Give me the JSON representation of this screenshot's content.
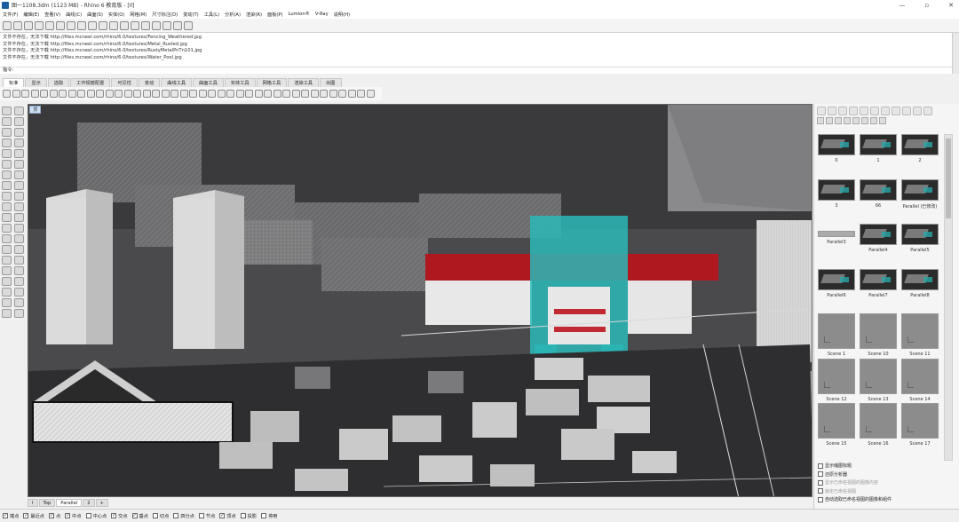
{
  "window": {
    "title": "图一1108.3dm (1123 MB) - Rhino 6 教育版 - [Il]",
    "controls": [
      "—",
      "▫",
      "✕"
    ]
  },
  "menu": [
    "文件(F)",
    "编辑(E)",
    "查看(V)",
    "曲线(C)",
    "曲面(S)",
    "实体(O)",
    "网格(M)",
    "尺寸标注(D)",
    "变动(T)",
    "工具(L)",
    "分析(A)",
    "渲染(R)",
    "面板(P)",
    "Lumion®",
    "V-Ray",
    "说明(H)"
  ],
  "command_history": [
    "文件不存在，无法下载 http://files.mcneel.com/rhino/6.0/textures/Fencing_Weathered.jpg",
    "文件不存在，无法下载 http://files.mcneel.com/rhino/6.0/textures/Metal_Rusted.jpg",
    "文件不存在，无法下载 http://files.mcneel.com/rhino/6.0/textures/RustyMetalPnTn101.jpg",
    "文件不存在，无法下载 http://files.mcneel.com/rhino/6.0/textures/Water_Pool.jpg"
  ],
  "command_prompt": "指令:",
  "toolbar_tabs": [
    "标准",
    "显示",
    "选取",
    "工作视窗配置",
    "可见性",
    "变动",
    "曲线工具",
    "曲面工具",
    "实体工具",
    "网格工具",
    "渲染工具",
    "出图"
  ],
  "viewport": {
    "label": "顶"
  },
  "viewport_tabs": [
    "I",
    "Top",
    "Parallel",
    "2",
    "+"
  ],
  "snaps": [
    {
      "label": "端点",
      "checked": true
    },
    {
      "label": "最近点",
      "checked": true
    },
    {
      "label": "点",
      "checked": true
    },
    {
      "label": "中点",
      "checked": true
    },
    {
      "label": "中心点",
      "checked": false
    },
    {
      "label": "交点",
      "checked": true
    },
    {
      "label": "垂点",
      "checked": true
    },
    {
      "label": "切点",
      "checked": false
    },
    {
      "label": "四分点",
      "checked": false
    },
    {
      "label": "节点",
      "checked": false
    },
    {
      "label": "顶点",
      "checked": true
    },
    {
      "label": "投影",
      "checked": false
    },
    {
      "label": "停用",
      "checked": false
    }
  ],
  "named_views": [
    {
      "label": "0",
      "kind": "dark"
    },
    {
      "label": "1",
      "kind": "dark"
    },
    {
      "label": "2",
      "kind": "dark"
    },
    {
      "label": "3",
      "kind": "dark"
    },
    {
      "label": "66",
      "kind": "dark"
    },
    {
      "label": "Parallel (已修改)",
      "kind": "dark"
    },
    {
      "label": "Parallel3",
      "kind": "blank"
    },
    {
      "label": "Parallel4",
      "kind": "dark"
    },
    {
      "label": "Parallel5",
      "kind": "dark"
    },
    {
      "label": "Parallel6",
      "kind": "dark"
    },
    {
      "label": "Parallel7",
      "kind": "dark"
    },
    {
      "label": "Parallel8",
      "kind": "dark"
    },
    {
      "label": "Scene 1",
      "kind": "scene"
    },
    {
      "label": "Scene 10",
      "kind": "scene"
    },
    {
      "label": "Scene 11",
      "kind": "scene"
    },
    {
      "label": "Scene 12",
      "kind": "scene"
    },
    {
      "label": "Scene 13",
      "kind": "scene"
    },
    {
      "label": "Scene 14",
      "kind": "scene"
    },
    {
      "label": "Scene 15",
      "kind": "scene"
    },
    {
      "label": "Scene 16",
      "kind": "scene"
    },
    {
      "label": "Scene 17",
      "kind": "scene"
    }
  ],
  "panel_options": [
    {
      "label": "显示缩图标题",
      "checked": false,
      "dim": false
    },
    {
      "label": "还原分析器",
      "checked": false,
      "dim": false
    },
    {
      "label": "显示已命名视图的图像内容",
      "checked": false,
      "dim": true
    },
    {
      "label": "锁定已命名视图",
      "checked": false,
      "dim": true
    },
    {
      "label": "自动选取已命名视图的图像和组件",
      "checked": false,
      "dim": false
    }
  ],
  "colors": {
    "accent_teal": "#2bb8b8",
    "accent_red": "#b01820",
    "viewport_bg": "#3a3a3c"
  }
}
